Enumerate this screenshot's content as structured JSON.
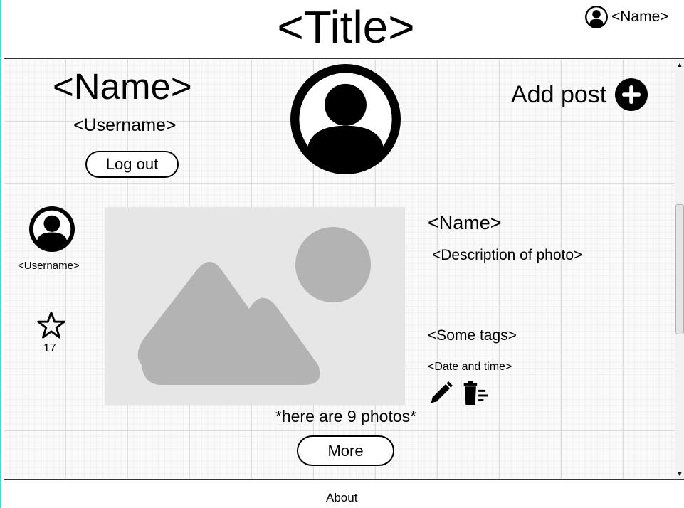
{
  "header": {
    "title": "<Title>",
    "user_menu": {
      "name": "<Name>",
      "icon": "user-circle-icon"
    }
  },
  "profile": {
    "name": "<Name>",
    "username": "<Username>",
    "logout_label": "Log out",
    "avatar_icon": "user-circle-icon"
  },
  "add_post": {
    "label": "Add post",
    "icon": "plus-circle-icon"
  },
  "post": {
    "author_username": "<Username>",
    "author_icon": "user-circle-icon",
    "favorite_icon": "star-outline-icon",
    "favorite_count": "17",
    "photo_icon": "image-placeholder-icon",
    "name": "<Name>",
    "description": "<Description of photo>",
    "tags": "<Some tags>",
    "datetime": "<Date and time>",
    "edit_icon": "pencil-icon",
    "delete_icon": "trash-icon"
  },
  "photos_note": "*here are 9 photos*",
  "more_label": "More",
  "footer": {
    "about_label": "About"
  },
  "scrollbar": {
    "up_arrow": "▲",
    "down_arrow": "▼"
  },
  "colors": {
    "accent_border": "#4fd4d8",
    "photo_bg": "#e6e6e6",
    "photo_fg": "#b3b3b3"
  }
}
